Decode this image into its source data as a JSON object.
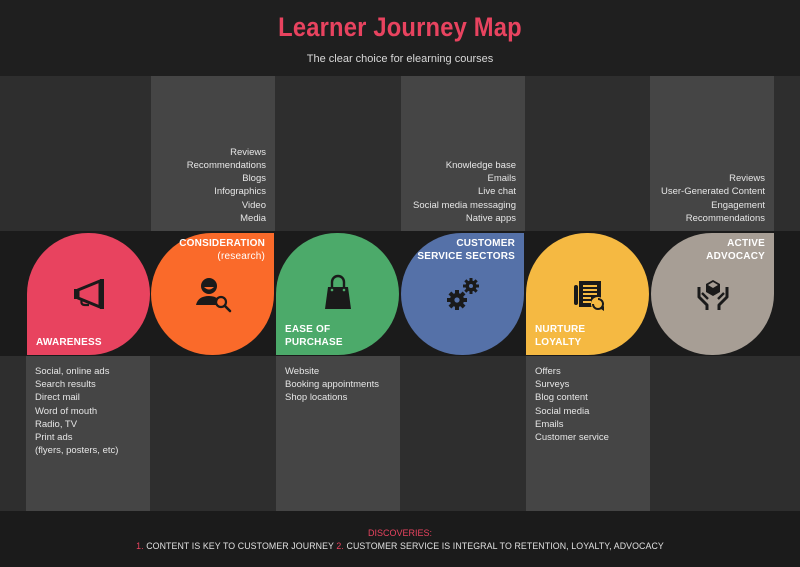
{
  "header": {
    "title": "Learner Journey Map",
    "subtitle": "The clear choice for elearning courses"
  },
  "colors": {
    "title": "#e8435f",
    "awareness": "#e8435f",
    "consideration": "#fa6a2a",
    "ease_of_purchase": "#4caa6a",
    "customer_service": "#5571a8",
    "nurture_loyalty": "#f5b942",
    "active_advocacy": "#a79e95"
  },
  "stages": [
    {
      "id": "awareness",
      "label_line1": "Awareness",
      "label_line2": "",
      "icon": "megaphone-icon",
      "details": [
        "Social, online ads",
        "Search results",
        "Direct mail",
        "Word of mouth",
        "Radio, TV",
        "Print ads",
        "(flyers, posters, etc)"
      ]
    },
    {
      "id": "consideration",
      "label_line1": "Consideration",
      "label_line2": "(research)",
      "icon": "user-search-icon",
      "details": [
        "Reviews",
        "Recommendations",
        "Blogs",
        "Infographics",
        "Video",
        "Media"
      ]
    },
    {
      "id": "ease-of-purchase",
      "label_line1": "Ease of",
      "label_line2": "Purchase",
      "icon": "shopping-bag-icon",
      "details": [
        "Website",
        "Booking appointments",
        "Shop locations"
      ]
    },
    {
      "id": "customer-service-sectors",
      "label_line1": "Customer",
      "label_line2": "Service Sectors",
      "icon": "gears-icon",
      "details": [
        "Knowledge base",
        "Emails",
        "Live chat",
        "Social media messaging",
        "Native apps"
      ]
    },
    {
      "id": "nurture-loyalty",
      "label_line1": "Nurture",
      "label_line2": "Loyalty",
      "icon": "newsletter-refresh-icon",
      "details": [
        "Offers",
        "Surveys",
        "Blog content",
        "Social media",
        "Emails",
        "Customer service"
      ]
    },
    {
      "id": "active-advocacy",
      "label_line1": "Active",
      "label_line2": "Advocacy",
      "icon": "hands-box-icon",
      "details": [
        "Reviews",
        "User-Generated Content",
        "Engagement",
        "Recommendations"
      ]
    }
  ],
  "footer": {
    "title": "DISCOVERIES:",
    "num1": "1.",
    "item1": "CONTENT IS KEY TO CUSTOMER JOURNEY",
    "num2": "2.",
    "item2": "CUSTOMER SERVICE IS INTEGRAL TO RETENTION, LOYALTY, ADVOCACY"
  }
}
